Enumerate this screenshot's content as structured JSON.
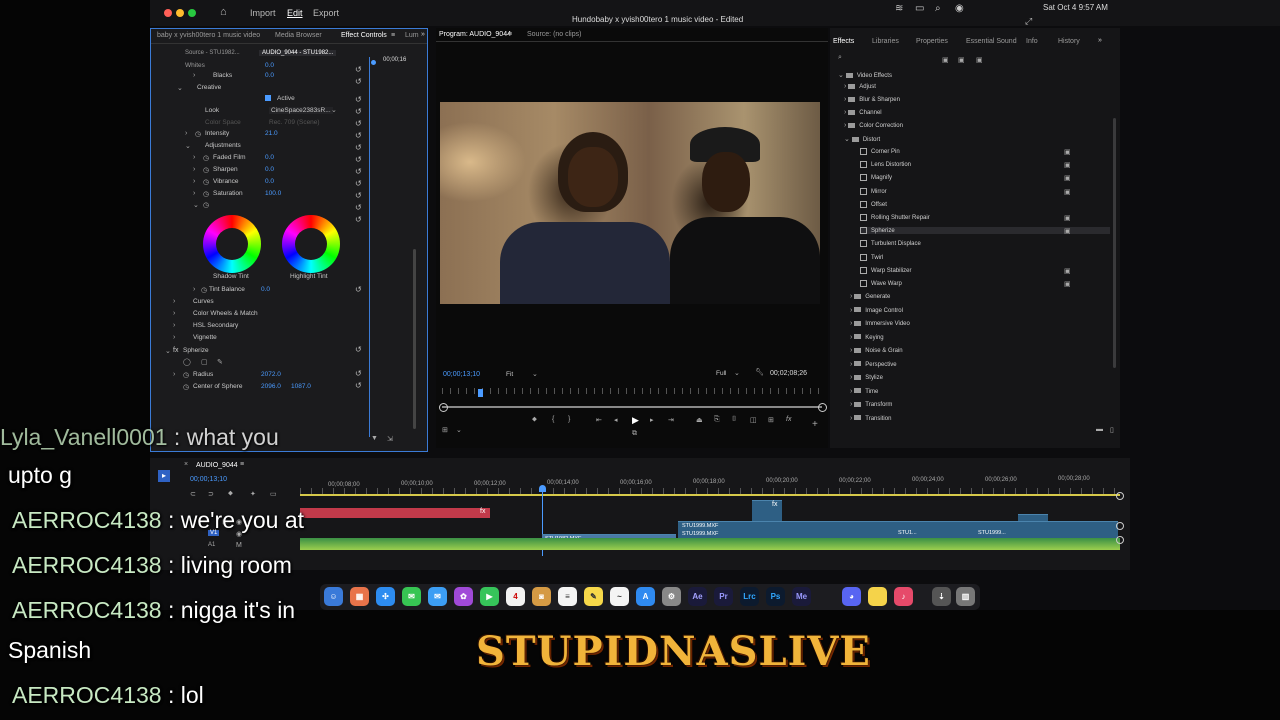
{
  "app": {
    "menu": [
      "Import",
      "Edit",
      "Export"
    ],
    "active_menu": "Edit",
    "window_title": "Hundobaby x yvish00tero 1 music video - Edited",
    "clock": "Sat Oct 4  9:57 AM"
  },
  "effect_controls": {
    "tabs": [
      "baby x yvish00tero 1 music video",
      "Media Browser",
      "Effect Controls",
      "Lum"
    ],
    "active_tab": "Effect Controls",
    "source_label": "Source - STU1982...",
    "clip_label": "AUDIO_9044 - STU1982...",
    "timecode": "00;00;16",
    "rows": [
      {
        "label": "Whites",
        "value": "0.0"
      },
      {
        "label": "Blacks",
        "value": "0.0"
      },
      {
        "label": "Creative",
        "value": ""
      },
      {
        "label": "Active",
        "value": ""
      },
      {
        "label": "Look",
        "value": "CineSpace2383sR..."
      },
      {
        "label": "Color Space",
        "value": "Rec. 709 (Scene)"
      },
      {
        "label": "Intensity",
        "value": "21.0"
      },
      {
        "label": "Adjustments",
        "value": ""
      },
      {
        "label": "Faded Film",
        "value": "0.0"
      },
      {
        "label": "Sharpen",
        "value": "0.0"
      },
      {
        "label": "Vibrance",
        "value": "0.0"
      },
      {
        "label": "Saturation",
        "value": "100.0"
      }
    ],
    "wheels": [
      "Shadow Tint",
      "Highlight Tint"
    ],
    "tint_balance": {
      "label": "Tint Balance",
      "value": "0.0"
    },
    "sections": [
      "Curves",
      "Color Wheels & Match",
      "HSL Secondary",
      "Vignette"
    ],
    "spherize": {
      "label": "Spherize",
      "radius_label": "Radius",
      "radius_value": "2072.0",
      "center_label": "Center of Sphere",
      "center_x": "2096.0",
      "center_y": "1087.0"
    }
  },
  "program": {
    "tab": "Program: AUDIO_9044",
    "source_tab": "Source: (no clips)",
    "current_tc": "00;00;13;10",
    "fit": "Fit",
    "quality": "Full",
    "duration_tc": "00;02;08;26"
  },
  "effects_panel": {
    "tabs": [
      "Effects",
      "Libraries",
      "Properties",
      "Essential Sound",
      "Info",
      "History"
    ],
    "active_tab": "Effects",
    "root": "Video Effects",
    "folders_top": [
      "Adjust",
      "Blur & Sharpen",
      "Channel",
      "Color Correction",
      "Distort"
    ],
    "distort_items": [
      "Corner Pin",
      "Lens Distortion",
      "Magnify",
      "Mirror",
      "Offset",
      "Rolling Shutter Repair",
      "Spherize",
      "Turbulent Displace",
      "Twirl",
      "Warp Stabilizer",
      "Wave Warp"
    ],
    "selected_item": "Spherize",
    "folders_bottom": [
      "Generate",
      "Image Control",
      "Immersive Video",
      "Keying",
      "Noise & Grain",
      "Perspective",
      "Stylize",
      "Time",
      "Transform",
      "Transition"
    ]
  },
  "timeline": {
    "sequence": "AUDIO_9044",
    "timecode": "00;00;13;10",
    "ruler": [
      "00;00;08;00",
      "00;00;10;00",
      "00;00;12;00",
      "00;00;14;00",
      "00;00;16;00",
      "00;00;18;00",
      "00;00;20;00",
      "00;00;22;00",
      "00;00;24;00",
      "00;00;26;00",
      "00;00;28;00"
    ],
    "clips": [
      "STU1999.MXF",
      "STU1999.MXF",
      "STU1982.MXF",
      "STU1...",
      "STU1999..."
    ]
  },
  "dock": [
    "Ae",
    "Pr",
    "Lrc",
    "Ps",
    "Me"
  ],
  "chat": {
    "lines": [
      {
        "user": "Lyla_Vanell0001",
        "sep": " : ",
        "text": "what you"
      },
      {
        "user": "",
        "sep": "",
        "text": "upto g"
      },
      {
        "user": "AERROC4138",
        "sep": " : ",
        "text": "we're you at"
      },
      {
        "user": "AERROC4138",
        "sep": " : ",
        "text": "living room"
      },
      {
        "user": "AERROC4138",
        "sep": " : ",
        "text": "nigga it's in"
      },
      {
        "user": "",
        "sep": "",
        "text": "Spanish"
      },
      {
        "user": "AERROC4138",
        "sep": " : ",
        "text": "lol"
      }
    ]
  },
  "brand": "STUPIDNASLIVE",
  "colors": {
    "accent_blue": "#3b7bd6",
    "value_blue": "#4b9bff",
    "brand_gold": "#f1b43a",
    "chat_user": "#c7e8c2"
  }
}
